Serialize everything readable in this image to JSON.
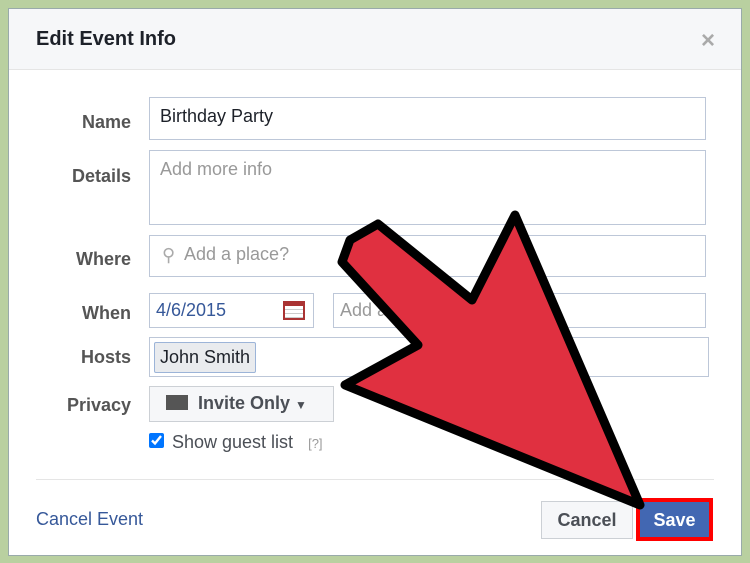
{
  "dialog": {
    "title": "Edit Event Info",
    "close": "×"
  },
  "form": {
    "name_label": "Name",
    "name_value": "Birthday Party",
    "details_label": "Details",
    "details_placeholder": "Add more info",
    "where_label": "Where",
    "where_placeholder": "Add a place?",
    "when_label": "When",
    "when_date": "4/6/2015",
    "when_time_placeholder": "Add a time?",
    "hosts_label": "Hosts",
    "host_token": "John Smith",
    "privacy_label": "Privacy",
    "privacy_value": "Invite Only",
    "show_guest_list": "Show guest list",
    "help": "[?]",
    "show_guest_list_checked": true
  },
  "footer": {
    "cancel_event": "Cancel Event",
    "cancel": "Cancel",
    "save": "Save"
  },
  "colors": {
    "arrow": "#e03040",
    "save_highlight": "#ff0000",
    "save": "#4267b2",
    "link": "#365899",
    "background": "#b9d0a0"
  }
}
